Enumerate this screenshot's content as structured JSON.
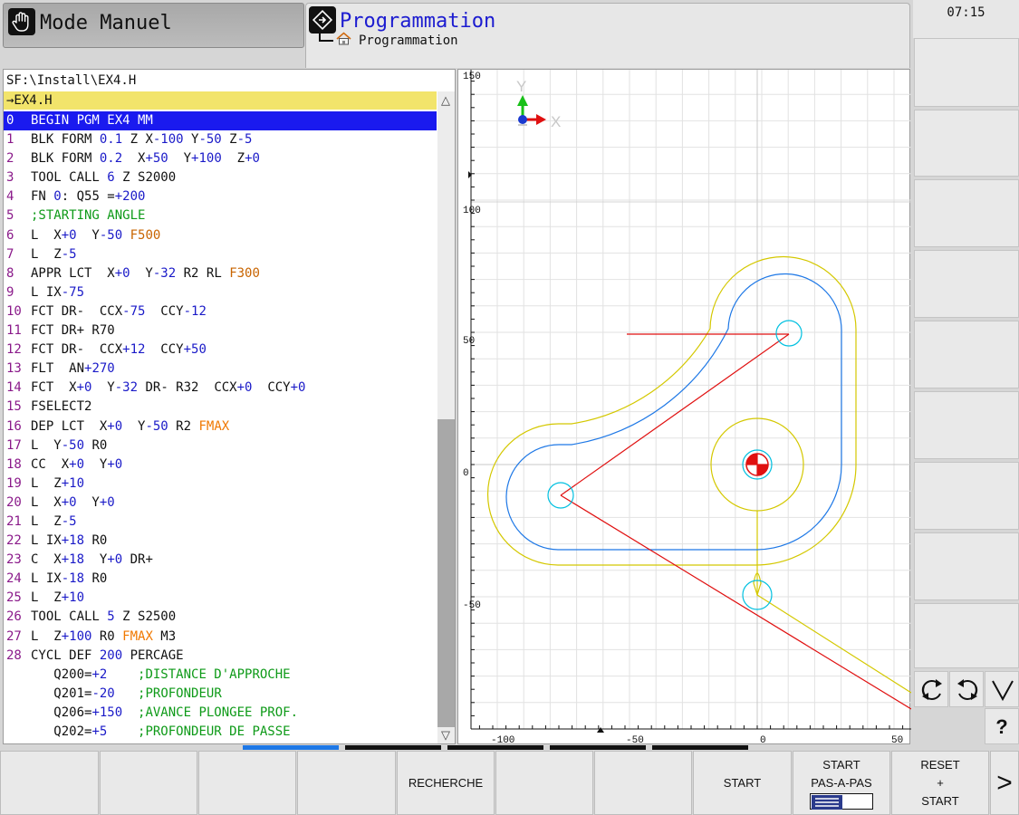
{
  "header": {
    "mode_label": "Mode Manuel",
    "program_title": "Programmation",
    "breadcrumb": "Programmation",
    "clock": "07:15"
  },
  "program": {
    "path": "SF:\\Install\\EX4.H",
    "file_bar": "→EX4.H",
    "selected_line": 0,
    "lines": [
      {
        "n": "0",
        "t": [
          [
            "k",
            "BEGIN PGM EX4 MM"
          ]
        ]
      },
      {
        "n": "1",
        "t": [
          [
            "k",
            "BLK FORM "
          ],
          [
            "v",
            "0.1"
          ],
          [
            "k",
            " Z X"
          ],
          [
            "v",
            "-100"
          ],
          [
            "k",
            " Y"
          ],
          [
            "v",
            "-50"
          ],
          [
            "k",
            " Z"
          ],
          [
            "v",
            "-5"
          ]
        ]
      },
      {
        "n": "2",
        "t": [
          [
            "k",
            "BLK FORM "
          ],
          [
            "v",
            "0.2"
          ],
          [
            "k",
            "  X"
          ],
          [
            "v",
            "+50"
          ],
          [
            "k",
            "  Y"
          ],
          [
            "v",
            "+100"
          ],
          [
            "k",
            "  Z"
          ],
          [
            "v",
            "+0"
          ]
        ]
      },
      {
        "n": "3",
        "t": [
          [
            "k",
            "TOOL CALL "
          ],
          [
            "v",
            "6"
          ],
          [
            "k",
            " Z S2000"
          ]
        ]
      },
      {
        "n": "4",
        "t": [
          [
            "k",
            "FN "
          ],
          [
            "v",
            "0"
          ],
          [
            "k",
            ": Q55 ="
          ],
          [
            "v",
            "+200"
          ]
        ]
      },
      {
        "n": "5",
        "t": [
          [
            "c",
            ";STARTING ANGLE"
          ]
        ]
      },
      {
        "n": "6",
        "t": [
          [
            "k",
            "L  X"
          ],
          [
            "v",
            "+0"
          ],
          [
            "k",
            "  Y"
          ],
          [
            "v",
            "-50"
          ],
          [
            "k",
            " "
          ],
          [
            "f",
            "F500"
          ]
        ]
      },
      {
        "n": "7",
        "t": [
          [
            "k",
            "L  Z"
          ],
          [
            "v",
            "-5"
          ]
        ]
      },
      {
        "n": "8",
        "t": [
          [
            "k",
            "APPR LCT  X"
          ],
          [
            "v",
            "+0"
          ],
          [
            "k",
            "  Y"
          ],
          [
            "v",
            "-32"
          ],
          [
            "k",
            " R2 RL "
          ],
          [
            "f",
            "F300"
          ]
        ]
      },
      {
        "n": "9",
        "t": [
          [
            "k",
            "L IX"
          ],
          [
            "v",
            "-75"
          ]
        ]
      },
      {
        "n": "10",
        "t": [
          [
            "k",
            "FCT DR-  CCX"
          ],
          [
            "v",
            "-75"
          ],
          [
            "k",
            "  CCY"
          ],
          [
            "v",
            "-12"
          ]
        ]
      },
      {
        "n": "11",
        "t": [
          [
            "k",
            "FCT DR+ R70"
          ]
        ]
      },
      {
        "n": "12",
        "t": [
          [
            "k",
            "FCT DR-  CCX"
          ],
          [
            "v",
            "+12"
          ],
          [
            "k",
            "  CCY"
          ],
          [
            "v",
            "+50"
          ]
        ]
      },
      {
        "n": "13",
        "t": [
          [
            "k",
            "FLT  AN"
          ],
          [
            "v",
            "+270"
          ]
        ]
      },
      {
        "n": "14",
        "t": [
          [
            "k",
            "FCT  X"
          ],
          [
            "v",
            "+0"
          ],
          [
            "k",
            "  Y"
          ],
          [
            "v",
            "-32"
          ],
          [
            "k",
            " DR- R32  CCX"
          ],
          [
            "v",
            "+0"
          ],
          [
            "k",
            "  CCY"
          ],
          [
            "v",
            "+0"
          ]
        ]
      },
      {
        "n": "15",
        "t": [
          [
            "k",
            "FSELECT2"
          ]
        ]
      },
      {
        "n": "16",
        "t": [
          [
            "k",
            "DEP LCT  X"
          ],
          [
            "v",
            "+0"
          ],
          [
            "k",
            "  Y"
          ],
          [
            "v",
            "-50"
          ],
          [
            "k",
            " R2 "
          ],
          [
            "m",
            "FMAX"
          ]
        ]
      },
      {
        "n": "17",
        "t": [
          [
            "k",
            "L  Y"
          ],
          [
            "v",
            "-50"
          ],
          [
            "k",
            " R0"
          ]
        ]
      },
      {
        "n": "18",
        "t": [
          [
            "k",
            "CC  X"
          ],
          [
            "v",
            "+0"
          ],
          [
            "k",
            "  Y"
          ],
          [
            "v",
            "+0"
          ]
        ]
      },
      {
        "n": "19",
        "t": [
          [
            "k",
            "L  Z"
          ],
          [
            "v",
            "+10"
          ]
        ]
      },
      {
        "n": "20",
        "t": [
          [
            "k",
            "L  X"
          ],
          [
            "v",
            "+0"
          ],
          [
            "k",
            "  Y"
          ],
          [
            "v",
            "+0"
          ]
        ]
      },
      {
        "n": "21",
        "t": [
          [
            "k",
            "L  Z"
          ],
          [
            "v",
            "-5"
          ]
        ]
      },
      {
        "n": "22",
        "t": [
          [
            "k",
            "L IX"
          ],
          [
            "v",
            "+18"
          ],
          [
            "k",
            " R0"
          ]
        ]
      },
      {
        "n": "23",
        "t": [
          [
            "k",
            "C  X"
          ],
          [
            "v",
            "+18"
          ],
          [
            "k",
            "  Y"
          ],
          [
            "v",
            "+0"
          ],
          [
            "k",
            " DR+"
          ]
        ]
      },
      {
        "n": "24",
        "t": [
          [
            "k",
            "L IX"
          ],
          [
            "v",
            "-18"
          ],
          [
            "k",
            " R0"
          ]
        ]
      },
      {
        "n": "25",
        "t": [
          [
            "k",
            "L  Z"
          ],
          [
            "v",
            "+10"
          ]
        ]
      },
      {
        "n": "26",
        "t": [
          [
            "k",
            "TOOL CALL "
          ],
          [
            "v",
            "5"
          ],
          [
            "k",
            " Z S2500"
          ]
        ]
      },
      {
        "n": "27",
        "t": [
          [
            "k",
            "L  Z"
          ],
          [
            "v",
            "+100"
          ],
          [
            "k",
            " R0 "
          ],
          [
            "m",
            "FMAX"
          ],
          [
            "k",
            " M3"
          ]
        ]
      },
      {
        "n": "28",
        "t": [
          [
            "k",
            "CYCL DEF "
          ],
          [
            "v",
            "200"
          ],
          [
            "k",
            " PERCAGE"
          ]
        ]
      },
      {
        "n": "",
        "t": [
          [
            "k",
            "   Q200="
          ],
          [
            "v",
            "+2"
          ],
          [
            "k",
            "    "
          ],
          [
            "c",
            ";DISTANCE D'APPROCHE"
          ]
        ]
      },
      {
        "n": "",
        "t": [
          [
            "k",
            "   Q201="
          ],
          [
            "v",
            "-20"
          ],
          [
            "k",
            "   "
          ],
          [
            "c",
            ";PROFONDEUR"
          ]
        ]
      },
      {
        "n": "",
        "t": [
          [
            "k",
            "   Q206="
          ],
          [
            "v",
            "+150"
          ],
          [
            "k",
            "  "
          ],
          [
            "c",
            ";AVANCE PLONGEE PROF."
          ]
        ]
      },
      {
        "n": "",
        "t": [
          [
            "k",
            "   Q202="
          ],
          [
            "v",
            "+5"
          ],
          [
            "k",
            "    "
          ],
          [
            "c",
            ";PROFONDEUR DE PASSE"
          ]
        ]
      }
    ]
  },
  "graphics": {
    "axis_x_label": "X",
    "axis_y_label": "Y",
    "x_ticks": [
      "-100",
      "-50",
      "0",
      "50"
    ],
    "y_ticks": [
      "150",
      "100",
      "50",
      "0",
      "-50"
    ],
    "colors": {
      "contour": "#1e78e6",
      "tool_path": "#d4c800",
      "rapid": "#e01010",
      "circle": "#00c0e0"
    }
  },
  "softkeys_bottom": {
    "k1": "",
    "k2": "",
    "k3": "",
    "k4": "",
    "k5": "RECHERCHE",
    "k6": "",
    "k7": "",
    "k8": "START",
    "k9_line1": "START",
    "k9_line2": "PAS-A-PAS",
    "k10_line1": "RESET",
    "k10_line2": "+",
    "k10_line3": "START",
    "more": ">"
  },
  "softkeys_right": {
    "help": "?"
  }
}
